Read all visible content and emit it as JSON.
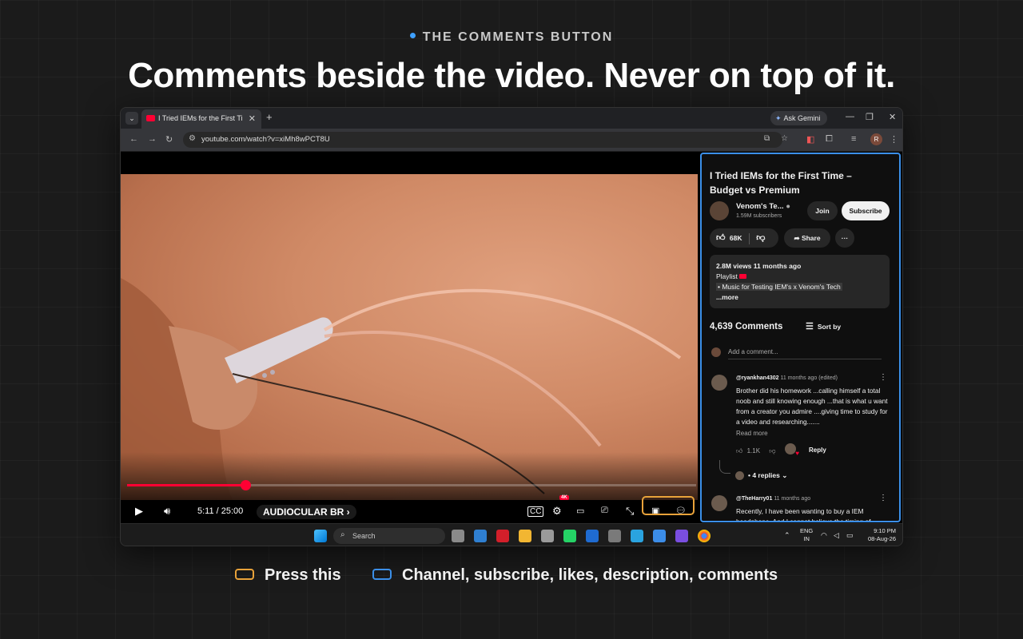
{
  "header": {
    "eyebrow": "THE COMMENTS BUTTON",
    "headline": "Comments beside the video. Never on top of it."
  },
  "colors": {
    "accent_blue": "#3b8fe8",
    "highlight_orange": "#e8a23a",
    "youtube_red": "#ff0033"
  },
  "browser": {
    "tab_title": "I Tried IEMs for the First Time –",
    "url": "youtube.com/watch?v=xiMh8wPCT8U",
    "gemini_label": "Ask Gemini",
    "profile_initial": "R"
  },
  "player": {
    "time": "5:11 / 25:00",
    "chapter": "AUDIOCULAR BR",
    "quality_badge": "4K",
    "progress_fraction": 0.208
  },
  "panel": {
    "title": "I Tried IEMs for the First Time – Budget vs Premium",
    "channel_name": "Venom's Te...",
    "subscribers": "1.59M subscribers",
    "join_label": "Join",
    "subscribe_label": "Subscribe",
    "likes": "68K",
    "share_label": "Share",
    "description": {
      "stats": "2.8M views  11 months ago",
      "playlist_label": "Playlist",
      "playlist_name": "• Music for Testing IEM's x Venom's Tech",
      "more": "...more"
    },
    "comments_count": "4,639 Comments",
    "sort_label": "Sort by",
    "add_comment_placeholder": "Add a comment...",
    "comments": [
      {
        "user": "@ryankhan4302",
        "meta": "11 months ago (edited)",
        "text": "Brother did his homework ...calling himself a total noob and still knowing enough ...that is what u want from a creator you admire ....giving time to study for a video and researching.......",
        "read_more": "Read more",
        "likes": "1.1K",
        "reply_label": "Reply",
        "replies_label": "4 replies"
      },
      {
        "user": "@TheHarry01",
        "meta": "11 months ago",
        "text": "Recently, I have been wanting to buy a IEM headphone. And I cannot believe the timing of"
      }
    ]
  },
  "taskbar": {
    "search_label": "Search",
    "lang_top": "ENG",
    "lang_bottom": "IN",
    "time": "9:10 PM",
    "date": "08-Aug-26"
  },
  "legend": {
    "press_label": "Press this",
    "panel_label": "Channel, subscribe, likes, description, comments"
  }
}
